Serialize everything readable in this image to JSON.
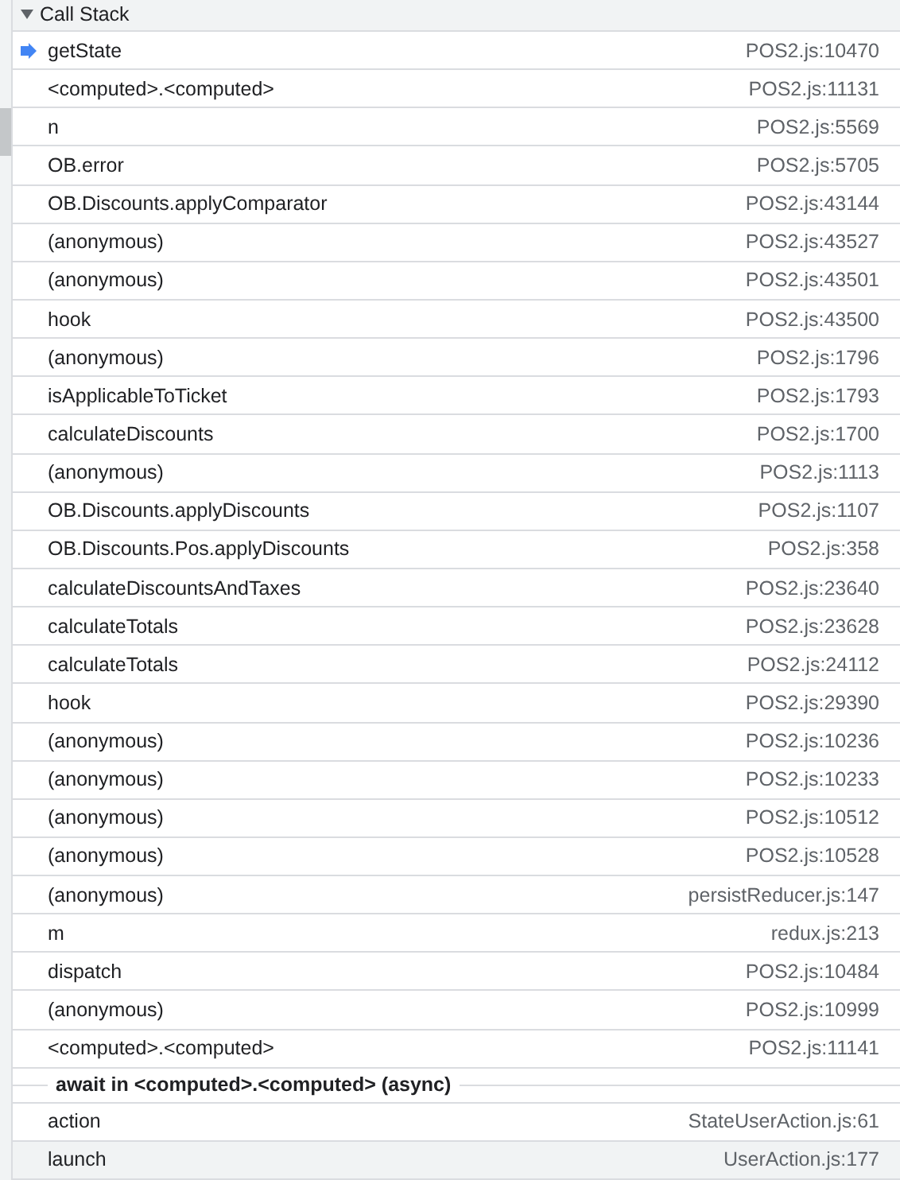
{
  "section": {
    "title": "Call Stack",
    "expanded": true
  },
  "frames": [
    {
      "kind": "frame",
      "name": "getState",
      "location": "POS2.js:10470",
      "selected": true,
      "hovered": false
    },
    {
      "kind": "frame",
      "name": "<computed>.<computed>",
      "location": "POS2.js:11131",
      "selected": false,
      "hovered": false
    },
    {
      "kind": "frame",
      "name": "n",
      "location": "POS2.js:5569",
      "selected": false,
      "hovered": false
    },
    {
      "kind": "frame",
      "name": "OB.error",
      "location": "POS2.js:5705",
      "selected": false,
      "hovered": false
    },
    {
      "kind": "frame",
      "name": "OB.Discounts.applyComparator",
      "location": "POS2.js:43144",
      "selected": false,
      "hovered": false
    },
    {
      "kind": "frame",
      "name": "(anonymous)",
      "location": "POS2.js:43527",
      "selected": false,
      "hovered": false
    },
    {
      "kind": "frame",
      "name": "(anonymous)",
      "location": "POS2.js:43501",
      "selected": false,
      "hovered": false
    },
    {
      "kind": "frame",
      "name": "hook",
      "location": "POS2.js:43500",
      "selected": false,
      "hovered": false
    },
    {
      "kind": "frame",
      "name": "(anonymous)",
      "location": "POS2.js:1796",
      "selected": false,
      "hovered": false
    },
    {
      "kind": "frame",
      "name": "isApplicableToTicket",
      "location": "POS2.js:1793",
      "selected": false,
      "hovered": false
    },
    {
      "kind": "frame",
      "name": "calculateDiscounts",
      "location": "POS2.js:1700",
      "selected": false,
      "hovered": false
    },
    {
      "kind": "frame",
      "name": "(anonymous)",
      "location": "POS2.js:1113",
      "selected": false,
      "hovered": false
    },
    {
      "kind": "frame",
      "name": "OB.Discounts.applyDiscounts",
      "location": "POS2.js:1107",
      "selected": false,
      "hovered": false
    },
    {
      "kind": "frame",
      "name": "OB.Discounts.Pos.applyDiscounts",
      "location": "POS2.js:358",
      "selected": false,
      "hovered": false
    },
    {
      "kind": "frame",
      "name": "calculateDiscountsAndTaxes",
      "location": "POS2.js:23640",
      "selected": false,
      "hovered": false
    },
    {
      "kind": "frame",
      "name": "calculateTotals",
      "location": "POS2.js:23628",
      "selected": false,
      "hovered": false
    },
    {
      "kind": "frame",
      "name": "calculateTotals",
      "location": "POS2.js:24112",
      "selected": false,
      "hovered": false
    },
    {
      "kind": "frame",
      "name": "hook",
      "location": "POS2.js:29390",
      "selected": false,
      "hovered": false
    },
    {
      "kind": "frame",
      "name": "(anonymous)",
      "location": "POS2.js:10236",
      "selected": false,
      "hovered": false
    },
    {
      "kind": "frame",
      "name": "(anonymous)",
      "location": "POS2.js:10233",
      "selected": false,
      "hovered": false
    },
    {
      "kind": "frame",
      "name": "(anonymous)",
      "location": "POS2.js:10512",
      "selected": false,
      "hovered": false
    },
    {
      "kind": "frame",
      "name": "(anonymous)",
      "location": "POS2.js:10528",
      "selected": false,
      "hovered": false
    },
    {
      "kind": "frame",
      "name": "(anonymous)",
      "location": "persistReducer.js:147",
      "selected": false,
      "hovered": false
    },
    {
      "kind": "frame",
      "name": "m",
      "location": "redux.js:213",
      "selected": false,
      "hovered": false
    },
    {
      "kind": "frame",
      "name": "dispatch",
      "location": "POS2.js:10484",
      "selected": false,
      "hovered": false
    },
    {
      "kind": "frame",
      "name": "(anonymous)",
      "location": "POS2.js:10999",
      "selected": false,
      "hovered": false
    },
    {
      "kind": "frame",
      "name": "<computed>.<computed>",
      "location": "POS2.js:11141",
      "selected": false,
      "hovered": false
    },
    {
      "kind": "async",
      "name": "await in <computed>.<computed> (async)"
    },
    {
      "kind": "frame",
      "name": "action",
      "location": "StateUserAction.js:61",
      "selected": false,
      "hovered": false
    },
    {
      "kind": "frame",
      "name": "launch",
      "location": "UserAction.js:177",
      "selected": false,
      "hovered": true
    }
  ]
}
